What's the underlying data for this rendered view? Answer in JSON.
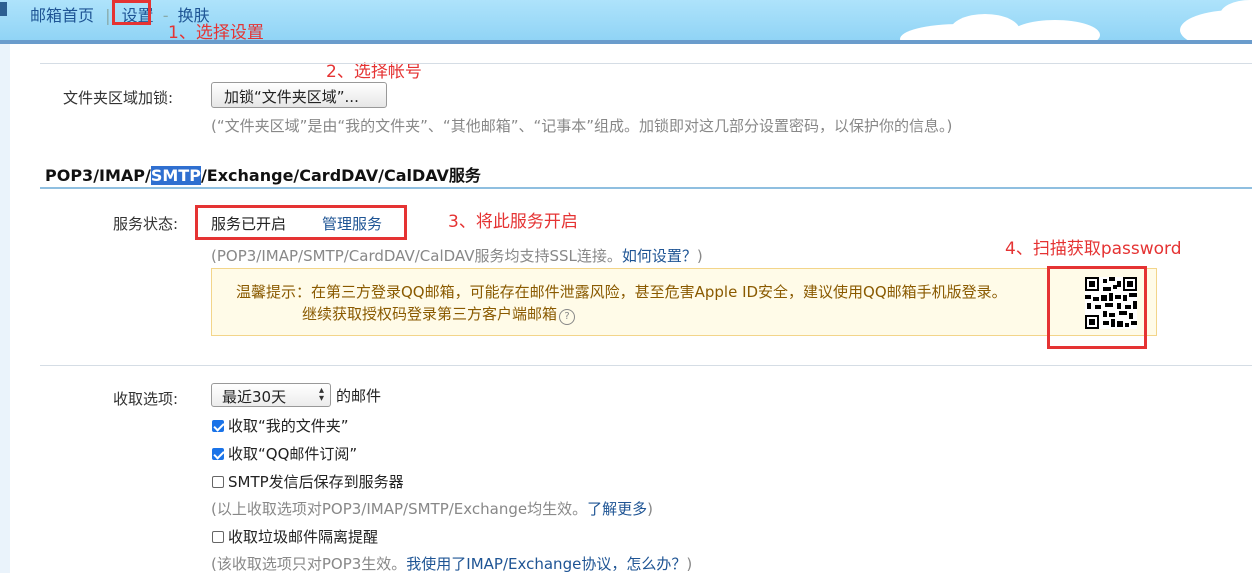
{
  "topnav": {
    "home": "邮箱首页",
    "sep": "|",
    "settings": "设置",
    "dash": "-",
    "skin": "换肤"
  },
  "annotations": {
    "step1": "1、选择设置",
    "step2": "2、选择帐号",
    "step3": "3、将此服务开启",
    "step4": "4、扫描获取password"
  },
  "folder_lock": {
    "label": "文件夹区域加锁:",
    "button": "加锁“文件夹区域”...",
    "note": "(“文件夹区域”是由“我的文件夹”、“其他邮箱”、“记事本”组成。加锁即对这几部分设置密码，以保护你的信息。)"
  },
  "service_section": {
    "title_prefix": "POP3/IMAP/",
    "title_highlight": "SMTP",
    "title_suffix": "/Exchange/CardDAV/CalDAV服务",
    "status_label": "服务状态:",
    "status_value": "服务已开启",
    "manage_link": "管理服务",
    "ssl_note_prefix": "(POP3/IMAP/SMTP/CardDAV/CalDAV服务均支持SSL连接。",
    "ssl_note_link": "如何设置？",
    "ssl_note_suffix": ")",
    "tip_line1": "温馨提示：在第三方登录QQ邮箱，可能存在邮件泄露风险，甚至危害Apple ID安全，建议使用QQ邮箱手机版登录。",
    "tip_line2": "继续获取授权码登录第三方客户端邮箱"
  },
  "receive": {
    "label": "收取选项:",
    "select_value": "最近30天",
    "select_suffix": "的邮件",
    "options": [
      {
        "label": "收取“我的文件夹”",
        "checked": true
      },
      {
        "label": "收取“QQ邮件订阅”",
        "checked": true
      },
      {
        "label": "SMTP发信后保存到服务器",
        "checked": false
      }
    ],
    "note1_prefix": "(以上收取选项对POP3/IMAP/SMTP/Exchange均生效。",
    "note1_link": "了解更多",
    "note1_suffix": ")",
    "spam_option": {
      "label": "收取垃圾邮件隔离提醒",
      "checked": false
    },
    "note2_prefix": "(该收取选项只对POP3生效。",
    "note2_link": "我使用了IMAP/Exchange协议，怎么办？",
    "note2_suffix": ")"
  },
  "colors": {
    "annotation_red": "#e53333",
    "link_blue": "#1e5494",
    "header_sky": "#9fdcf8",
    "tip_bg": "#fffbe8"
  }
}
